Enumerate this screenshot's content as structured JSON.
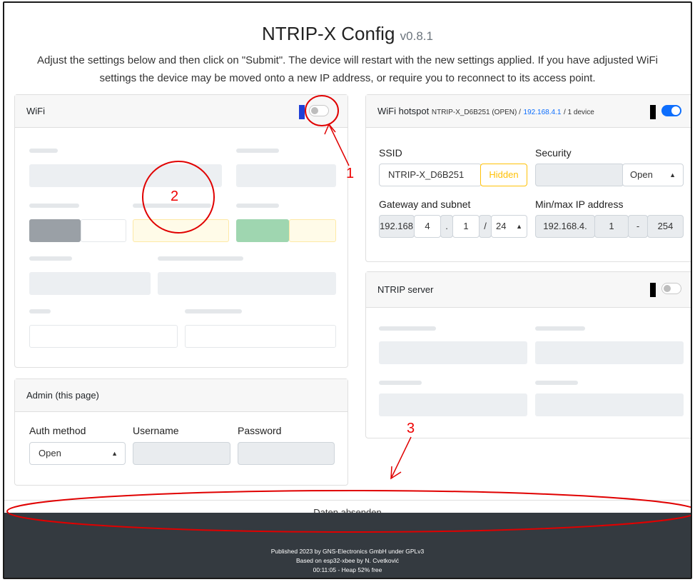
{
  "header": {
    "title": "NTRIP-X Config",
    "version": "v0.8.1",
    "instructions_line1": "Adjust the settings below and then click on \"Submit\". The device will restart with the new settings applied. If you have adjusted WiFi",
    "instructions_line2": "settings the device may be moved onto a new IP address, or require you to reconnect to its access point."
  },
  "wifi": {
    "title": "WiFi",
    "enabled": false
  },
  "hotspot": {
    "title": "WiFi hotspot",
    "ssid_info": "NTRIP-X_D6B251 (OPEN) /",
    "ip_link": "192.168.4.1",
    "devices": "/ 1 device",
    "enabled": true,
    "ssid_label": "SSID",
    "ssid_value": "NTRIP-X_D6B251",
    "hidden_label": "Hidden",
    "security_label": "Security",
    "security_value": "Open",
    "gateway_label": "Gateway and subnet",
    "gateway_prefix": "192.168.",
    "gateway_octet3": "4",
    "gateway_dot": ".",
    "gateway_octet4": "1",
    "gateway_slash": "/",
    "subnet_value": "24",
    "minmax_label": "Min/max IP address",
    "min_prefix": "192.168.4.",
    "min_value": "1",
    "minmax_sep": "-",
    "max_value": "254"
  },
  "ntrip": {
    "title": "NTRIP server",
    "enabled": false
  },
  "admin": {
    "title": "Admin (this page)",
    "auth_label": "Auth method",
    "auth_value": "Open",
    "username_label": "Username",
    "password_label": "Password"
  },
  "submit_label": "Daten absenden",
  "footer": {
    "line1": "Published 2023 by GNS-Electronics GmbH under GPLv3",
    "line2": "Based on esp32-xbee by N. Cvetković",
    "line3": "00:11:05 - Heap 52% free"
  },
  "annotations": {
    "one": "1",
    "two": "2",
    "three": "3"
  },
  "colors": {
    "accent": "#0d6efd",
    "warning": "#ffc107",
    "annotation": "#e00000",
    "footer_bg": "#343a40"
  }
}
